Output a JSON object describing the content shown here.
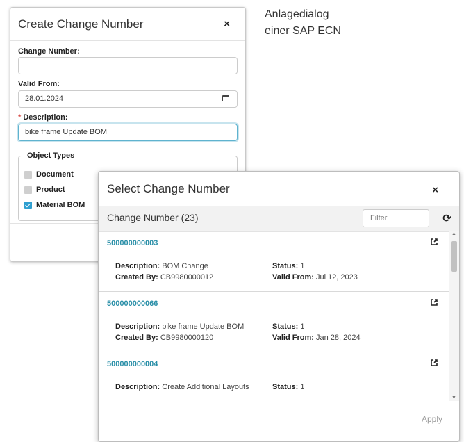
{
  "caption": {
    "line1": "Anlagedialog",
    "line2": "einer SAP ECN"
  },
  "create_dialog": {
    "title": "Create Change Number",
    "close": "×",
    "change_number_label": "Change Number:",
    "change_number_value": "",
    "valid_from_label": "Valid From:",
    "valid_from_value": "28.01.2024",
    "description_required": "*",
    "description_label": " Description:",
    "description_value": "bike frame Update BOM",
    "object_types_legend": "Object Types",
    "object_types": [
      {
        "label": "Document",
        "checked": false
      },
      {
        "label": "Product",
        "checked": false
      },
      {
        "label": "Material BOM",
        "checked": true
      }
    ]
  },
  "select_dialog": {
    "title": "Select Change Number",
    "close": "×",
    "list_title": "Change Number (23)",
    "filter_placeholder": "Filter",
    "refresh_icon": "refresh-icon",
    "items": [
      {
        "id": "500000000003",
        "description_label": "Description:",
        "description": "BOM Change",
        "created_label": "Created By:",
        "created_by": "CB9980000012",
        "status_label": "Status:",
        "status": "1",
        "valid_label": "Valid From:",
        "valid_from": "Jul 12, 2023"
      },
      {
        "id": "500000000066",
        "description_label": "Description:",
        "description": "bike frame Update BOM",
        "created_label": "Created By:",
        "created_by": "CB9980000120",
        "status_label": "Status:",
        "status": "1",
        "valid_label": "Valid From:",
        "valid_from": "Jan 28, 2024"
      },
      {
        "id": "500000000004",
        "description_label": "Description:",
        "description": "Create Additional Layouts",
        "status_label": "Status:",
        "status": "1"
      }
    ],
    "apply_label": "Apply"
  },
  "colors": {
    "accent": "#2a8fa8",
    "focus": "#5fb3cf",
    "checkbox": "#2f9fd0",
    "required": "#d9534f"
  }
}
